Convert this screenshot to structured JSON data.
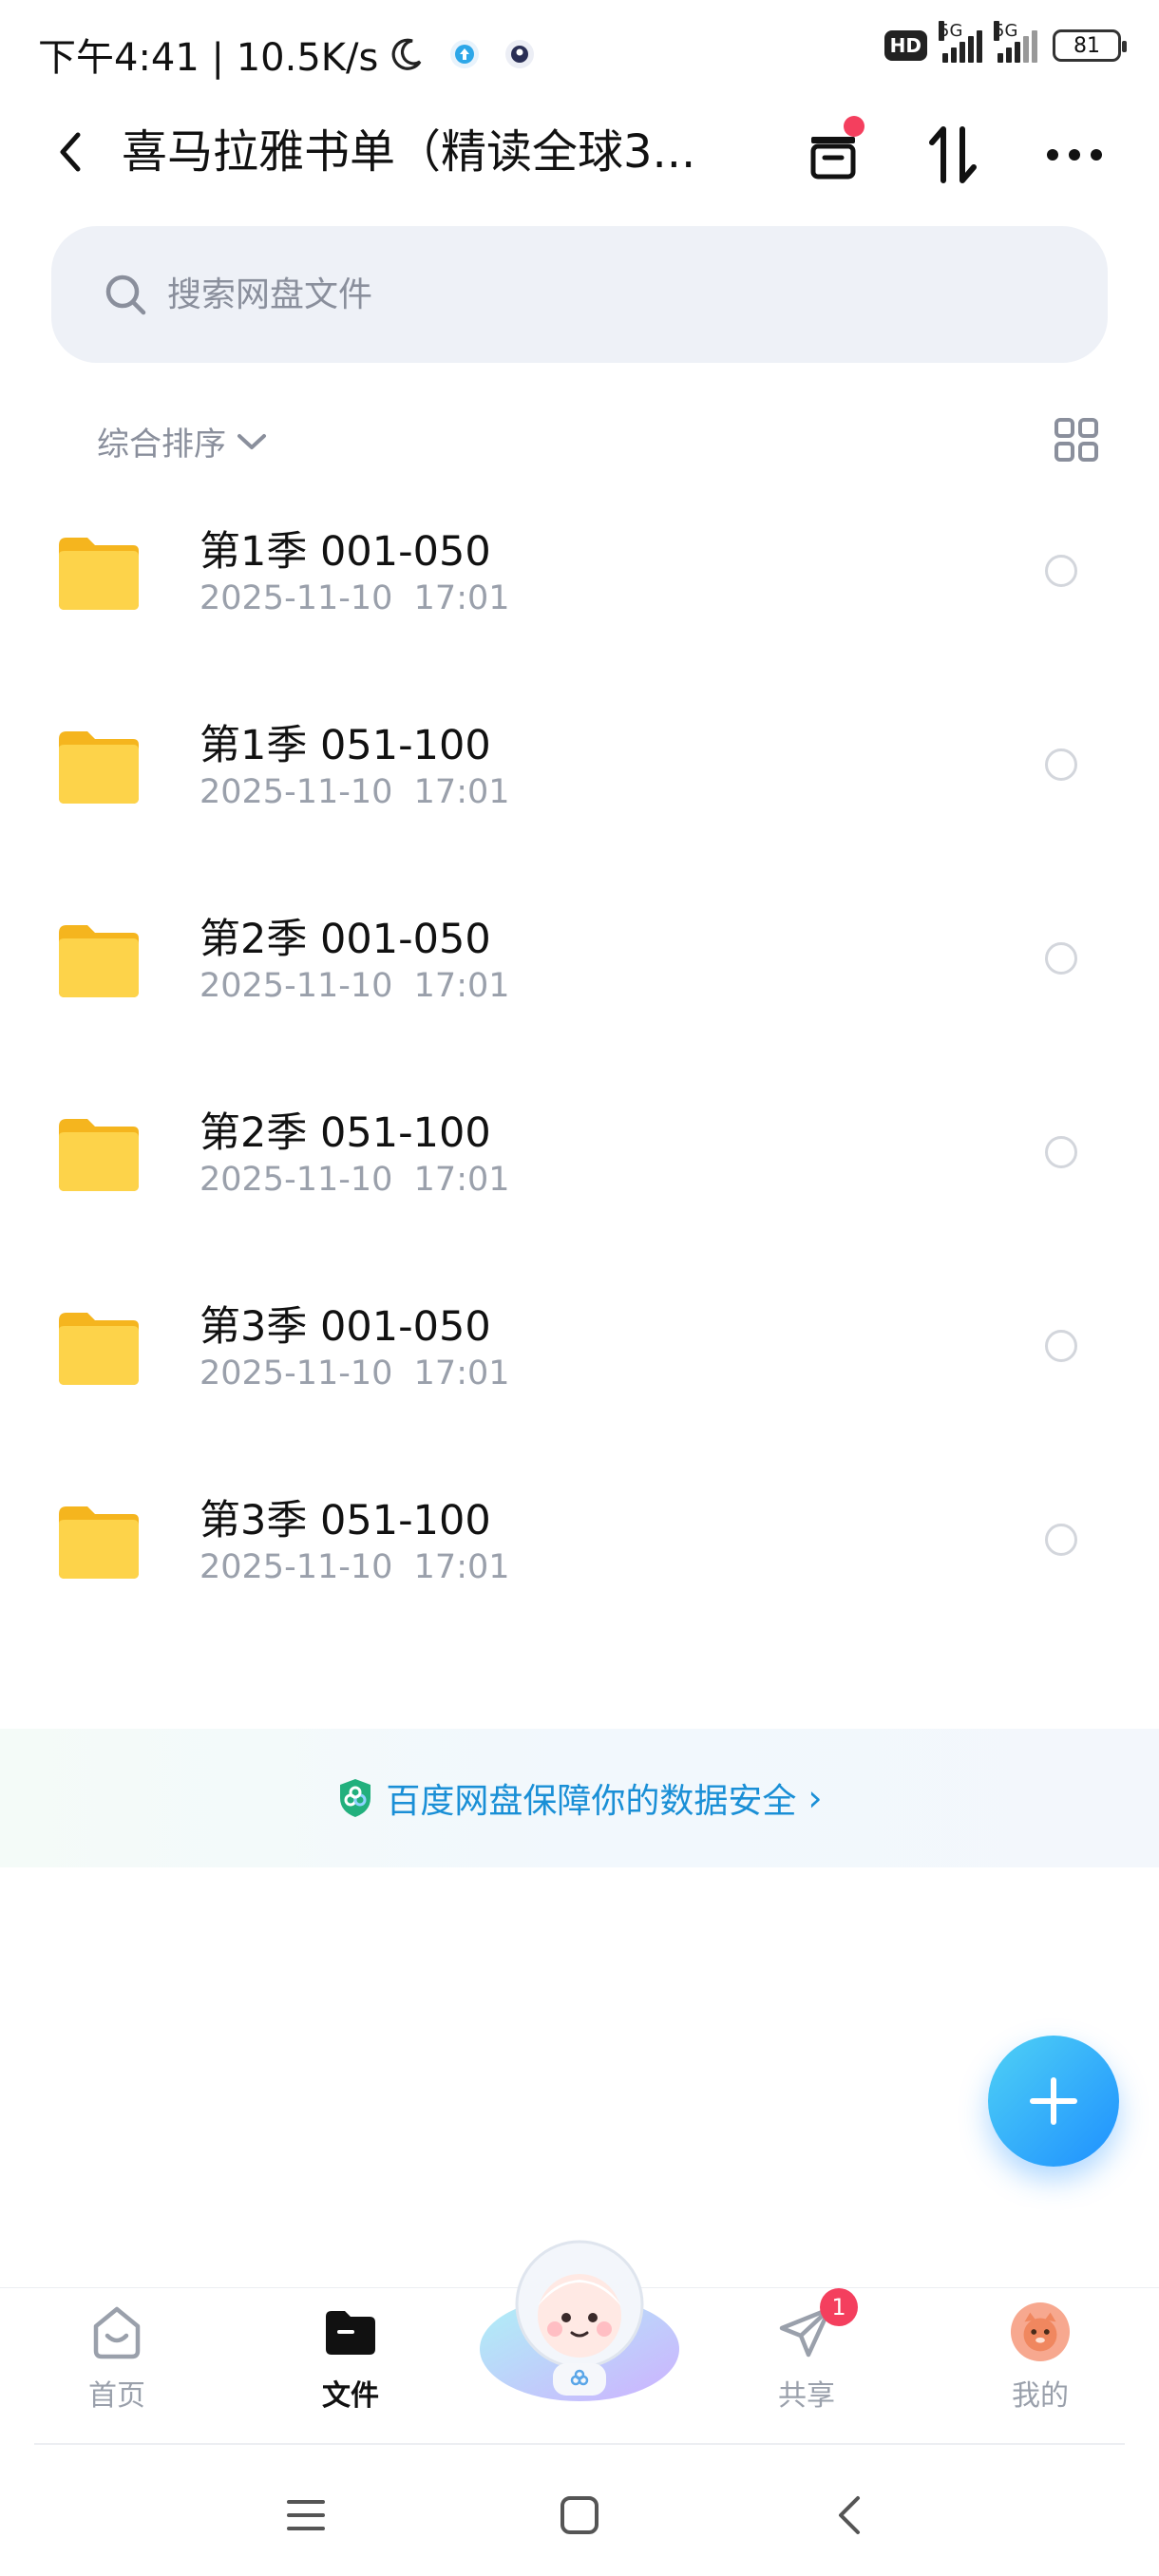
{
  "status_bar": {
    "time_speed": "下午4:41 | 10.5K/s",
    "hd": "HD",
    "network": "5G",
    "battery": "81"
  },
  "header": {
    "title": "喜马拉雅书单（精读全球3..."
  },
  "search": {
    "placeholder": "搜索网盘文件"
  },
  "sort": {
    "label": "综合排序"
  },
  "files": [
    {
      "name": "第1季 001-050",
      "date": "2025-11-10  17:01"
    },
    {
      "name": "第1季 051-100",
      "date": "2025-11-10  17:01"
    },
    {
      "name": "第2季 001-050",
      "date": "2025-11-10  17:01"
    },
    {
      "name": "第2季 051-100",
      "date": "2025-11-10  17:01"
    },
    {
      "name": "第3季 001-050",
      "date": "2025-11-10  17:01"
    },
    {
      "name": "第3季 051-100",
      "date": "2025-11-10  17:01"
    }
  ],
  "security": {
    "text": "百度网盘保障你的数据安全",
    "chevron": "›"
  },
  "nav": {
    "home": "首页",
    "files": "文件",
    "share": "共享",
    "share_badge": "1",
    "mine": "我的"
  },
  "colors": {
    "accent": "#1e90ff",
    "folder": "#fbbf24",
    "badge": "#f43f5e"
  }
}
